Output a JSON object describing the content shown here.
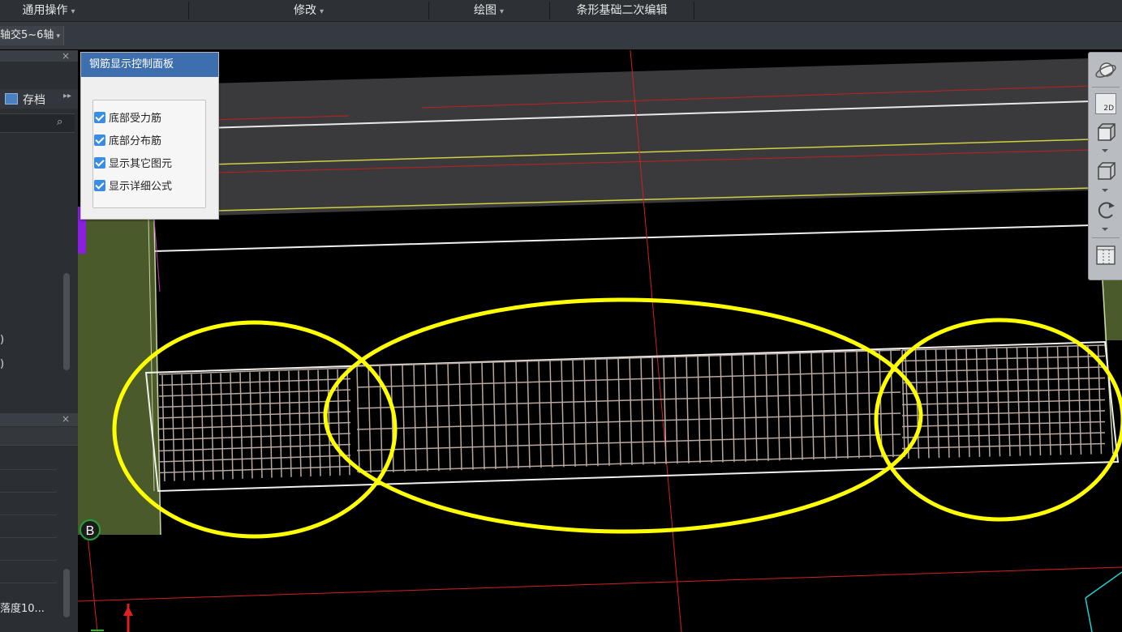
{
  "menubar": {
    "items": [
      {
        "label": "通用操作",
        "has_dropdown": true
      },
      {
        "label": "修改",
        "has_dropdown": true
      },
      {
        "label": "绘图",
        "has_dropdown": true
      },
      {
        "label": "条形基础二次编辑",
        "has_dropdown": false
      }
    ],
    "caret": "▾"
  },
  "toolbar": {
    "axis_select": "轴交5~6轴",
    "caret": "▾"
  },
  "left_panel": {
    "close": "×",
    "archive_label": "存档",
    "more": "▸▸",
    "search_icon": "⌕",
    "paren_1": ")",
    "paren_2": ")",
    "close_2": "×",
    "bottom_text": "落度10..."
  },
  "rebar_panel": {
    "title": "钢筋显示控制面板",
    "options": [
      {
        "label": "底部受力筋",
        "checked": true
      },
      {
        "label": "底部分布筋",
        "checked": true
      },
      {
        "label": "显示其它图元",
        "checked": true
      },
      {
        "label": "显示详细公式",
        "checked": true
      }
    ]
  },
  "viewport": {
    "axis_label": "B",
    "highlight_color": "#ffff00",
    "rebar_color": "#b8a8a0",
    "axis_line_color": "#d22020"
  },
  "view_tools": {
    "twod_label": "2D",
    "icons": [
      "orbit-icon",
      "2d-view-icon",
      "3d-box-icon",
      "3d-solid-icon",
      "rotate-icon",
      "layout-icon"
    ]
  }
}
